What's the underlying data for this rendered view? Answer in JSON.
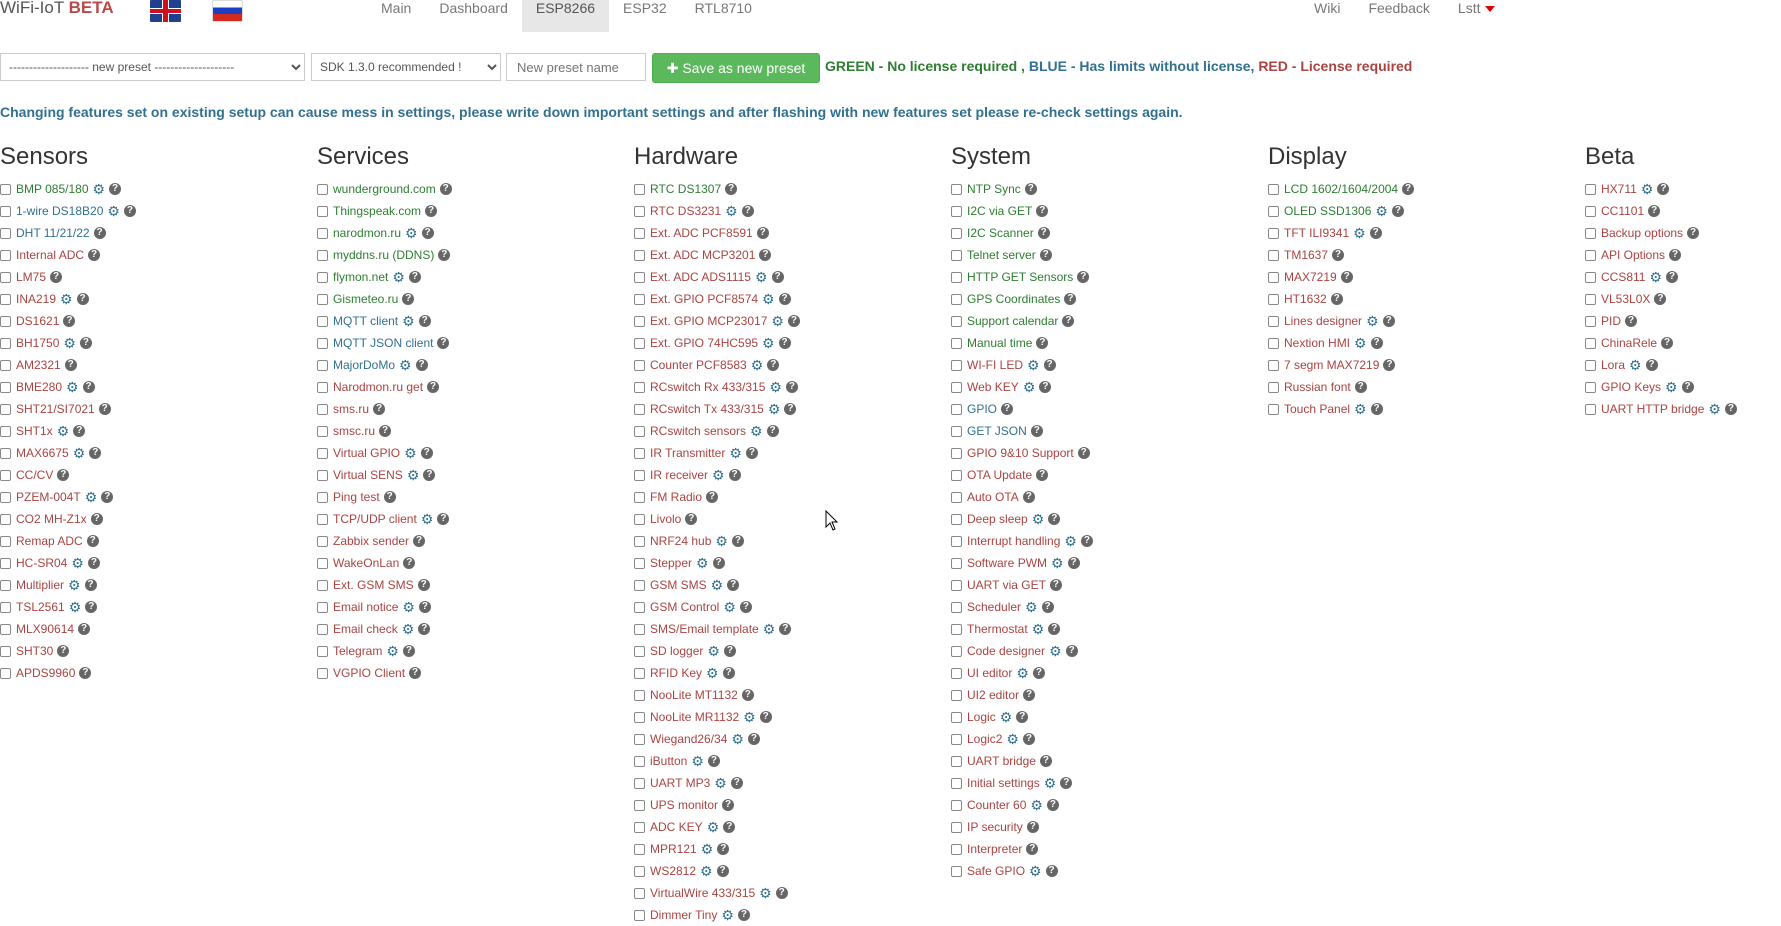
{
  "brand": {
    "title": "WiFi-IoT",
    "beta": "BETA"
  },
  "nav": {
    "left": [
      "Main",
      "Dashboard",
      "ESP8266",
      "ESP32",
      "RTL8710"
    ],
    "right": [
      "Wiki",
      "Feedback",
      "Lstt"
    ]
  },
  "toolbar": {
    "preset_select": "-------------------- new preset --------------------",
    "sdk_select": "SDK 1.3.0 recommended !",
    "preset_placeholder": "New preset name",
    "save_label": "Save as new preset",
    "legend_green": "GREEN - No license required ,",
    "legend_blue": "BLUE - Has limits without license,",
    "legend_red": "RED - License required"
  },
  "warning": "Changing features set on existing setup can cause mess in settings, please write down important settings and after flashing with new features set please re-check settings again.",
  "colors": {
    "green": "#2e7d32",
    "blue": "#31708f",
    "red": "#a94442",
    "save_button": "#5cb85c"
  },
  "columns": [
    {
      "title": "Sensors",
      "items": [
        {
          "label": "BMP 085/180",
          "c": "green",
          "gear": true
        },
        {
          "label": "1-wire DS18B20",
          "c": "blue",
          "gear": true
        },
        {
          "label": "DHT 11/21/22",
          "c": "blue",
          "gear": false
        },
        {
          "label": "Internal ADC",
          "c": "red",
          "gear": false
        },
        {
          "label": "LM75",
          "c": "red",
          "gear": false
        },
        {
          "label": "INA219",
          "c": "red",
          "gear": true
        },
        {
          "label": "DS1621",
          "c": "red",
          "gear": false
        },
        {
          "label": "BH1750",
          "c": "red",
          "gear": true
        },
        {
          "label": "AM2321",
          "c": "red",
          "gear": false
        },
        {
          "label": "BME280",
          "c": "red",
          "gear": true
        },
        {
          "label": "SHT21/SI7021",
          "c": "red",
          "gear": false
        },
        {
          "label": "SHT1x",
          "c": "red",
          "gear": true
        },
        {
          "label": "MAX6675",
          "c": "red",
          "gear": true
        },
        {
          "label": "CC/CV",
          "c": "red",
          "gear": false
        },
        {
          "label": "PZEM-004T",
          "c": "red",
          "gear": true
        },
        {
          "label": "CO2 MH-Z1x",
          "c": "red",
          "gear": false
        },
        {
          "label": "Remap ADC",
          "c": "red",
          "gear": false
        },
        {
          "label": "HC-SR04",
          "c": "red",
          "gear": true
        },
        {
          "label": "Multiplier",
          "c": "red",
          "gear": true
        },
        {
          "label": "TSL2561",
          "c": "red",
          "gear": true
        },
        {
          "label": "MLX90614",
          "c": "red",
          "gear": false
        },
        {
          "label": "SHT30",
          "c": "red",
          "gear": false
        },
        {
          "label": "APDS9960",
          "c": "red",
          "gear": false
        }
      ]
    },
    {
      "title": "Services",
      "items": [
        {
          "label": "wunderground.com",
          "c": "green",
          "gear": false
        },
        {
          "label": "Thingspeak.com",
          "c": "green",
          "gear": false
        },
        {
          "label": "narodmon.ru",
          "c": "green",
          "gear": true
        },
        {
          "label": "myddns.ru (DDNS)",
          "c": "green",
          "gear": false
        },
        {
          "label": "flymon.net",
          "c": "green",
          "gear": true
        },
        {
          "label": "Gismeteo.ru",
          "c": "green",
          "gear": false
        },
        {
          "label": "MQTT client",
          "c": "blue",
          "gear": true
        },
        {
          "label": "MQTT JSON client",
          "c": "blue",
          "gear": false
        },
        {
          "label": "MajorDoMo",
          "c": "blue",
          "gear": true
        },
        {
          "label": "Narodmon.ru get",
          "c": "red",
          "gear": false
        },
        {
          "label": "sms.ru",
          "c": "red",
          "gear": false
        },
        {
          "label": "smsc.ru",
          "c": "red",
          "gear": false
        },
        {
          "label": "Virtual GPIO",
          "c": "red",
          "gear": true
        },
        {
          "label": "Virtual SENS",
          "c": "red",
          "gear": true
        },
        {
          "label": "Ping test",
          "c": "red",
          "gear": false
        },
        {
          "label": "TCP/UDP client",
          "c": "red",
          "gear": true
        },
        {
          "label": "Zabbix sender",
          "c": "red",
          "gear": false
        },
        {
          "label": "WakeOnLan",
          "c": "red",
          "gear": false
        },
        {
          "label": "Ext. GSM SMS",
          "c": "red",
          "gear": false
        },
        {
          "label": "Email notice",
          "c": "red",
          "gear": true
        },
        {
          "label": "Email check",
          "c": "red",
          "gear": true
        },
        {
          "label": "Telegram",
          "c": "red",
          "gear": true
        },
        {
          "label": "VGPIO Client",
          "c": "red",
          "gear": false
        }
      ]
    },
    {
      "title": "Hardware",
      "items": [
        {
          "label": "RTC DS1307",
          "c": "green",
          "gear": false
        },
        {
          "label": "RTC DS3231",
          "c": "red",
          "gear": true
        },
        {
          "label": "Ext. ADC PCF8591",
          "c": "red",
          "gear": false
        },
        {
          "label": "Ext. ADC MCP3201",
          "c": "red",
          "gear": false
        },
        {
          "label": "Ext. ADC ADS1115",
          "c": "red",
          "gear": true
        },
        {
          "label": "Ext. GPIO PCF8574",
          "c": "red",
          "gear": true
        },
        {
          "label": "Ext. GPIO MCP23017",
          "c": "red",
          "gear": true
        },
        {
          "label": "Ext. GPIO 74HC595",
          "c": "red",
          "gear": true
        },
        {
          "label": "Counter PCF8583",
          "c": "red",
          "gear": true
        },
        {
          "label": "RCswitch Rx 433/315",
          "c": "red",
          "gear": true
        },
        {
          "label": "RCswitch Tx 433/315",
          "c": "red",
          "gear": true
        },
        {
          "label": "RCswitch sensors",
          "c": "red",
          "gear": true
        },
        {
          "label": "IR Transmitter",
          "c": "red",
          "gear": true
        },
        {
          "label": "IR receiver",
          "c": "red",
          "gear": true
        },
        {
          "label": "FM Radio",
          "c": "red",
          "gear": false
        },
        {
          "label": "Livolo",
          "c": "red",
          "gear": false
        },
        {
          "label": "NRF24 hub",
          "c": "red",
          "gear": true
        },
        {
          "label": "Stepper",
          "c": "red",
          "gear": true
        },
        {
          "label": "GSM SMS",
          "c": "red",
          "gear": true
        },
        {
          "label": "GSM Control",
          "c": "red",
          "gear": true
        },
        {
          "label": "SMS/Email template",
          "c": "red",
          "gear": true
        },
        {
          "label": "SD logger",
          "c": "red",
          "gear": true
        },
        {
          "label": "RFID Key",
          "c": "red",
          "gear": true
        },
        {
          "label": "NooLite MT1132",
          "c": "red",
          "gear": false
        },
        {
          "label": "NooLite MR1132",
          "c": "red",
          "gear": true
        },
        {
          "label": "Wiegand26/34",
          "c": "red",
          "gear": true
        },
        {
          "label": "iButton",
          "c": "red",
          "gear": true
        },
        {
          "label": "UART MP3",
          "c": "red",
          "gear": true
        },
        {
          "label": "UPS monitor",
          "c": "red",
          "gear": false
        },
        {
          "label": "ADC KEY",
          "c": "red",
          "gear": true
        },
        {
          "label": "MPR121",
          "c": "red",
          "gear": true
        },
        {
          "label": "WS2812",
          "c": "red",
          "gear": true
        },
        {
          "label": "VirtualWire 433/315",
          "c": "red",
          "gear": true
        },
        {
          "label": "Dimmer Tiny",
          "c": "red",
          "gear": true
        }
      ]
    },
    {
      "title": "System",
      "items": [
        {
          "label": "NTP Sync",
          "c": "green",
          "gear": false
        },
        {
          "label": "I2C via GET",
          "c": "green",
          "gear": false
        },
        {
          "label": "I2C Scanner",
          "c": "green",
          "gear": false
        },
        {
          "label": "Telnet server",
          "c": "green",
          "gear": false
        },
        {
          "label": "HTTP GET Sensors",
          "c": "green",
          "gear": false
        },
        {
          "label": "GPS Coordinates",
          "c": "green",
          "gear": false
        },
        {
          "label": "Support calendar",
          "c": "green",
          "gear": false
        },
        {
          "label": "Manual time",
          "c": "green",
          "gear": false
        },
        {
          "label": "WI-FI LED",
          "c": "red",
          "gear": true
        },
        {
          "label": "Web KEY",
          "c": "red",
          "gear": true
        },
        {
          "label": "GPIO",
          "c": "blue",
          "gear": false
        },
        {
          "label": "GET JSON",
          "c": "blue",
          "gear": false
        },
        {
          "label": "GPIO 9&10 Support",
          "c": "red",
          "gear": false
        },
        {
          "label": "OTA Update",
          "c": "red",
          "gear": false
        },
        {
          "label": "Auto OTA",
          "c": "red",
          "gear": false
        },
        {
          "label": "Deep sleep",
          "c": "red",
          "gear": true
        },
        {
          "label": "Interrupt handling",
          "c": "red",
          "gear": true
        },
        {
          "label": "Software PWM",
          "c": "red",
          "gear": true
        },
        {
          "label": "UART via GET",
          "c": "red",
          "gear": false
        },
        {
          "label": "Scheduler",
          "c": "red",
          "gear": true
        },
        {
          "label": "Thermostat",
          "c": "red",
          "gear": true
        },
        {
          "label": "Code designer",
          "c": "red",
          "gear": true
        },
        {
          "label": "UI editor",
          "c": "red",
          "gear": true
        },
        {
          "label": "UI2 editor",
          "c": "red",
          "gear": false
        },
        {
          "label": "Logic",
          "c": "red",
          "gear": true
        },
        {
          "label": "Logic2",
          "c": "red",
          "gear": true
        },
        {
          "label": "UART bridge",
          "c": "red",
          "gear": false
        },
        {
          "label": "Initial settings",
          "c": "red",
          "gear": true
        },
        {
          "label": "Counter 60",
          "c": "red",
          "gear": true
        },
        {
          "label": "IP security",
          "c": "red",
          "gear": false
        },
        {
          "label": "Interpreter",
          "c": "red",
          "gear": false
        },
        {
          "label": "Safe GPIO",
          "c": "red",
          "gear": true
        }
      ]
    },
    {
      "title": "Display",
      "items": [
        {
          "label": "LCD 1602/1604/2004",
          "c": "green",
          "gear": false
        },
        {
          "label": "OLED SSD1306",
          "c": "green",
          "gear": true
        },
        {
          "label": "TFT ILI9341",
          "c": "red",
          "gear": true
        },
        {
          "label": "TM1637",
          "c": "red",
          "gear": false
        },
        {
          "label": "MAX7219",
          "c": "red",
          "gear": false
        },
        {
          "label": "HT1632",
          "c": "red",
          "gear": false
        },
        {
          "label": "Lines designer",
          "c": "red",
          "gear": true
        },
        {
          "label": "Nextion HMI",
          "c": "red",
          "gear": true
        },
        {
          "label": "7 segm MAX7219",
          "c": "red",
          "gear": false
        },
        {
          "label": "Russian font",
          "c": "red",
          "gear": false
        },
        {
          "label": "Touch Panel",
          "c": "red",
          "gear": true
        }
      ]
    },
    {
      "title": "Beta",
      "items": [
        {
          "label": "HX711",
          "c": "red",
          "gear": true
        },
        {
          "label": "CC1101",
          "c": "red",
          "gear": false
        },
        {
          "label": "Backup options",
          "c": "red",
          "gear": false
        },
        {
          "label": "API Options",
          "c": "red",
          "gear": false
        },
        {
          "label": "CCS811",
          "c": "red",
          "gear": true
        },
        {
          "label": "VL53L0X",
          "c": "red",
          "gear": false
        },
        {
          "label": "PID",
          "c": "red",
          "gear": false
        },
        {
          "label": "ChinaRele",
          "c": "red",
          "gear": false
        },
        {
          "label": "Lora",
          "c": "red",
          "gear": true
        },
        {
          "label": "GPIO Keys",
          "c": "red",
          "gear": true
        },
        {
          "label": "UART HTTP bridge",
          "c": "red",
          "gear": true
        }
      ]
    }
  ]
}
